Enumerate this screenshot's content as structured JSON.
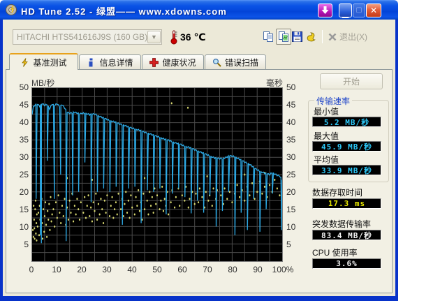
{
  "window": {
    "title": "HD Tune 2.52 - 绿盟—— www.xdowns.com"
  },
  "toolbar": {
    "drive_selected": "HITACHI HTS541616J9S (160 GB)",
    "temperature_value": "36",
    "temperature_unit": "℃",
    "exit_label": "退出(X)"
  },
  "tabs": [
    {
      "label": "基准测试"
    },
    {
      "label": "信息详情"
    },
    {
      "label": "健康状况"
    },
    {
      "label": "错误扫描"
    }
  ],
  "benchmark": {
    "start_label": "开始",
    "transfer_group_label": "传输速率",
    "stats": {
      "min": {
        "label": "最小值",
        "value": "5.2 MB/秒"
      },
      "max": {
        "label": "最大值",
        "value": "45.9 MB/秒"
      },
      "avg": {
        "label": "平均值",
        "value": "33.9 MB/秒"
      },
      "access": {
        "label": "数据存取时间",
        "value": "17.3 ms"
      },
      "burst": {
        "label": "突发数据传输率",
        "value": "83.4 MB/秒"
      },
      "cpu": {
        "label": "CPU 使用率",
        "value": "3.6%"
      }
    }
  },
  "chart_data": {
    "type": "line",
    "title": "",
    "background": "#000000",
    "grid_color": "#4a4a4a",
    "grid": {
      "x_step_percent": 5,
      "y_step_value": 2.5
    },
    "left_axis": {
      "label": "MB/秒",
      "min": 0,
      "max": 50,
      "ticks": [
        50,
        45,
        40,
        35,
        30,
        25,
        20,
        15,
        10,
        5
      ]
    },
    "right_axis": {
      "label": "毫秒",
      "min": 0,
      "max": 50,
      "ticks": [
        50,
        45,
        40,
        35,
        30,
        25,
        20,
        15,
        10,
        5
      ]
    },
    "x_axis": {
      "min": 0,
      "max": 100,
      "tick_values": [
        0,
        10,
        20,
        30,
        40,
        50,
        60,
        70,
        80,
        90,
        100
      ],
      "tick_labels": [
        "0",
        "10",
        "20",
        "30",
        "40",
        "50",
        "60",
        "70",
        "80",
        "90",
        "100%"
      ]
    },
    "transfer_rate_line": {
      "name": "传输速率 (MB/秒)",
      "color": "#2da9e4",
      "baseline": [
        [
          0,
          42.5
        ],
        [
          0.5,
          44.5
        ],
        [
          1,
          45
        ],
        [
          2,
          45.3
        ],
        [
          3,
          44.8
        ],
        [
          4,
          45.5
        ],
        [
          5,
          45
        ],
        [
          6,
          45.3
        ],
        [
          7,
          44
        ],
        [
          8,
          45.4
        ],
        [
          9,
          45
        ],
        [
          10,
          45.5
        ],
        [
          11,
          44.5
        ],
        [
          12,
          45.2
        ],
        [
          13,
          44.2
        ],
        [
          14,
          43
        ],
        [
          15,
          42.7
        ],
        [
          17,
          43
        ],
        [
          19,
          42.5
        ],
        [
          21,
          42.8
        ],
        [
          23,
          42.3
        ],
        [
          25,
          42.5
        ],
        [
          27,
          41.8
        ],
        [
          29,
          41.2
        ],
        [
          31,
          40.6
        ],
        [
          33,
          40.2
        ],
        [
          35,
          39.6
        ],
        [
          37,
          39.2
        ],
        [
          39,
          38.6
        ],
        [
          41,
          38.2
        ],
        [
          43,
          37.8
        ],
        [
          45,
          37.2
        ],
        [
          47,
          36.8
        ],
        [
          49,
          36.2
        ],
        [
          51,
          35.8
        ],
        [
          53,
          35.2
        ],
        [
          55,
          34.8
        ],
        [
          57,
          34.2
        ],
        [
          59,
          33.8
        ],
        [
          61,
          33.2
        ],
        [
          63,
          32.8
        ],
        [
          65,
          32.2
        ],
        [
          67,
          31.6
        ],
        [
          69,
          31
        ],
        [
          71,
          30.4
        ],
        [
          73,
          29.8
        ],
        [
          75,
          29.6
        ],
        [
          77,
          29.8
        ],
        [
          79,
          30.4
        ],
        [
          81,
          30.2
        ],
        [
          83,
          29.4
        ],
        [
          85,
          28.6
        ],
        [
          87,
          28
        ],
        [
          89,
          26.8
        ],
        [
          91,
          26
        ],
        [
          93,
          25.4
        ],
        [
          95,
          25
        ],
        [
          96,
          25.6
        ],
        [
          97,
          25.2
        ],
        [
          98,
          24.8
        ],
        [
          99,
          24.6
        ],
        [
          100,
          23.5
        ]
      ],
      "dips": [
        [
          1.6,
          18
        ],
        [
          3.3,
          7.5
        ],
        [
          3.7,
          5.2
        ],
        [
          6.1,
          29
        ],
        [
          8.9,
          18
        ],
        [
          11.4,
          25
        ],
        [
          13.6,
          5.8
        ],
        [
          16.2,
          19
        ],
        [
          18.6,
          20
        ],
        [
          21.1,
          28.5
        ],
        [
          23.6,
          17
        ],
        [
          26.1,
          20
        ],
        [
          28.6,
          21
        ],
        [
          31.1,
          20
        ],
        [
          33.6,
          21.5
        ],
        [
          36.1,
          10.5
        ],
        [
          38.6,
          21
        ],
        [
          41.1,
          21.5
        ],
        [
          43.6,
          11
        ],
        [
          46.1,
          20.5
        ],
        [
          48.6,
          20
        ],
        [
          51.1,
          21
        ],
        [
          53.6,
          13.5
        ],
        [
          56.1,
          19.5
        ],
        [
          58.6,
          21
        ],
        [
          61.1,
          18.5
        ],
        [
          63.6,
          13.8
        ],
        [
          66.1,
          17.5
        ],
        [
          68.6,
          14
        ],
        [
          71.1,
          19
        ],
        [
          73.6,
          10
        ],
        [
          76.1,
          14.5
        ],
        [
          78.6,
          20
        ],
        [
          81.1,
          7.5
        ],
        [
          83.6,
          14
        ],
        [
          86.1,
          9
        ],
        [
          88.6,
          18
        ],
        [
          91.1,
          8.5
        ],
        [
          93.6,
          15
        ],
        [
          96.1,
          19.5
        ],
        [
          99.8,
          9
        ]
      ]
    },
    "access_time_dots": {
      "name": "存取时间 (毫秒)",
      "color": "#d8d870",
      "points": [
        [
          0.3,
          9
        ],
        [
          0.5,
          7
        ],
        [
          0.8,
          12
        ],
        [
          1,
          6.5
        ],
        [
          1.2,
          15
        ],
        [
          1.5,
          8
        ],
        [
          1.7,
          11
        ],
        [
          1.9,
          13.5
        ],
        [
          0.6,
          16
        ],
        [
          1.4,
          17.5
        ],
        [
          0.9,
          9.5
        ],
        [
          1.8,
          6
        ],
        [
          2.2,
          10
        ],
        [
          2.5,
          14
        ],
        [
          2.8,
          7.5
        ],
        [
          3,
          16
        ],
        [
          3.2,
          12
        ],
        [
          3.5,
          9
        ],
        [
          3.8,
          18
        ],
        [
          4,
          11
        ],
        [
          4.2,
          6.5
        ],
        [
          4.5,
          15
        ],
        [
          4.8,
          8.5
        ],
        [
          5,
          13
        ],
        [
          5.3,
          17
        ],
        [
          5.6,
          10.5
        ],
        [
          5.9,
          7
        ],
        [
          6.2,
          14.5
        ],
        [
          6.5,
          12
        ],
        [
          6.8,
          16.5
        ],
        [
          7.1,
          9
        ],
        [
          7.4,
          18.5
        ],
        [
          7.7,
          11.5
        ],
        [
          8,
          13.5
        ],
        [
          8.5,
          15
        ],
        [
          9,
          10
        ],
        [
          9.5,
          17
        ],
        [
          10,
          12.5
        ],
        [
          10.5,
          19
        ],
        [
          11,
          14
        ],
        [
          11.5,
          11
        ],
        [
          12,
          16
        ],
        [
          12.5,
          13
        ],
        [
          13,
          18
        ],
        [
          13.5,
          10.5
        ],
        [
          14,
          15.5
        ],
        [
          14.5,
          12
        ],
        [
          15,
          17.5
        ],
        [
          15.5,
          14
        ],
        [
          16,
          19.5
        ],
        [
          16.5,
          11.5
        ],
        [
          17,
          16
        ],
        [
          17.5,
          13.5
        ],
        [
          18,
          18
        ],
        [
          18.5,
          15
        ],
        [
          19,
          12
        ],
        [
          19.5,
          17
        ],
        [
          20.5,
          14
        ],
        [
          21,
          18.5
        ],
        [
          21.5,
          12.5
        ],
        [
          22,
          16
        ],
        [
          22.5,
          19
        ],
        [
          23,
          13
        ],
        [
          23.5,
          15.5
        ],
        [
          24,
          11.5
        ],
        [
          24.5,
          17
        ],
        [
          25,
          14.5
        ],
        [
          25.5,
          19.5
        ],
        [
          26,
          12
        ],
        [
          26.5,
          16.5
        ],
        [
          27,
          13.5
        ],
        [
          27.5,
          18
        ],
        [
          28,
          15
        ],
        [
          28.5,
          11
        ],
        [
          29,
          17.5
        ],
        [
          29.5,
          14
        ],
        [
          30,
          19
        ],
        [
          31,
          13
        ],
        [
          31.5,
          16
        ],
        [
          32,
          18.5
        ],
        [
          32.5,
          12.5
        ],
        [
          33,
          15
        ],
        [
          33.5,
          17
        ],
        [
          34,
          13.5
        ],
        [
          34.5,
          19.5
        ],
        [
          35.5,
          15
        ],
        [
          36,
          18
        ],
        [
          36.5,
          13
        ],
        [
          37,
          16.5
        ],
        [
          37.5,
          20
        ],
        [
          38,
          14
        ],
        [
          38.5,
          17.5
        ],
        [
          39,
          12.5
        ],
        [
          39.5,
          19
        ],
        [
          40,
          15.5
        ],
        [
          41,
          13.5
        ],
        [
          41.5,
          18.5
        ],
        [
          42,
          16
        ],
        [
          42.5,
          20.5
        ],
        [
          43,
          14.5
        ],
        [
          43.5,
          17
        ],
        [
          44,
          12
        ],
        [
          44.5,
          19.5
        ],
        [
          45,
          15
        ],
        [
          46,
          17.5
        ],
        [
          46.5,
          13.5
        ],
        [
          47,
          20
        ],
        [
          47.5,
          16
        ],
        [
          48,
          18.5
        ],
        [
          48.5,
          14
        ],
        [
          49,
          21
        ],
        [
          49.5,
          16.5
        ],
        [
          50,
          19
        ],
        [
          51,
          15
        ],
        [
          51.5,
          17.5
        ],
        [
          52,
          21.5
        ],
        [
          52.5,
          14.5
        ],
        [
          53,
          18
        ],
        [
          53.5,
          16
        ],
        [
          54,
          20
        ],
        [
          54.5,
          13.5
        ],
        [
          55.5,
          17
        ],
        [
          56,
          20.5
        ],
        [
          57,
          15.5
        ],
        [
          57.5,
          18.5
        ],
        [
          58.5,
          21
        ],
        [
          59,
          16
        ],
        [
          60,
          19
        ],
        [
          61,
          17.5
        ],
        [
          61.5,
          21.5
        ],
        [
          62.5,
          15.5
        ],
        [
          63,
          18
        ],
        [
          64,
          20
        ],
        [
          65,
          16.5
        ],
        [
          65.5,
          19.5
        ],
        [
          66.5,
          17
        ],
        [
          67,
          21
        ],
        [
          68,
          18.5
        ],
        [
          69,
          15.5
        ],
        [
          69.5,
          20
        ],
        [
          70.5,
          17.5
        ],
        [
          71,
          19
        ],
        [
          72,
          16
        ],
        [
          72.5,
          21
        ],
        [
          73.5,
          18
        ],
        [
          74,
          20.5
        ],
        [
          75.5,
          19
        ],
        [
          76.5,
          16.5
        ],
        [
          77,
          21
        ],
        [
          78,
          18
        ],
        [
          79,
          20
        ],
        [
          80,
          17
        ],
        [
          81,
          19.5
        ],
        [
          82,
          22
        ],
        [
          83,
          18.5
        ],
        [
          84,
          20.5
        ],
        [
          85,
          17.5
        ],
        [
          86,
          21.5
        ],
        [
          87,
          19
        ],
        [
          88,
          22.5
        ],
        [
          89,
          18
        ],
        [
          90,
          20
        ],
        [
          91,
          23
        ],
        [
          92,
          19.5
        ],
        [
          93,
          21.5
        ],
        [
          94,
          18.5
        ],
        [
          95,
          22
        ],
        [
          96,
          20
        ],
        [
          97,
          23.5
        ],
        [
          98,
          21
        ],
        [
          99,
          19
        ],
        [
          55.8,
          45.6
        ],
        [
          62.3,
          44.3
        ],
        [
          14,
          24
        ],
        [
          24,
          23.5
        ],
        [
          45,
          24
        ],
        [
          70,
          24.5
        ],
        [
          85,
          25
        ],
        [
          93,
          25.5
        ]
      ]
    }
  }
}
